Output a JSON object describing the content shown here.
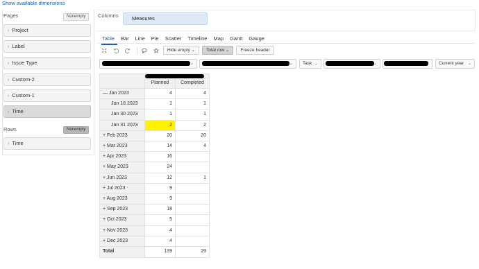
{
  "top_link": "Show available dimensions",
  "pages": {
    "heading": "Pages",
    "nonempty": "Nonempty",
    "items": [
      {
        "label": "Project"
      },
      {
        "label": "Label"
      },
      {
        "label": "Issue Type"
      },
      {
        "label": "Custom-2"
      },
      {
        "label": "Custom-1"
      },
      {
        "label": "Time"
      }
    ]
  },
  "rows": {
    "heading": "Rows",
    "nonempty": "Nonempty",
    "items": [
      {
        "label": "Time"
      }
    ]
  },
  "columns": {
    "heading": "Columns",
    "measures": "Measures"
  },
  "tabs": [
    "Table",
    "Bar",
    "Line",
    "Pie",
    "Scatter",
    "Timeline",
    "Map",
    "Gantt",
    "Gauge"
  ],
  "toolbar": {
    "hide_empty": "Hide empty",
    "total_row": "Total row",
    "freeze_header": "Freeze header",
    "icons": [
      "collapse-icon",
      "undo-icon",
      "redo-icon",
      "comment-icon",
      "bookmark-icon"
    ]
  },
  "filters": {
    "task": "Task",
    "current_year": "Current year"
  },
  "table": {
    "col_headers": [
      "Planned",
      "Completed"
    ],
    "rows": [
      {
        "label": "— Jan 2023",
        "planned": "4",
        "completed": "4",
        "indent": false
      },
      {
        "label": "Jan 18 2023",
        "planned": "1",
        "completed": "1",
        "indent": true
      },
      {
        "label": "Jan 30 2023",
        "planned": "1",
        "completed": "1",
        "indent": true
      },
      {
        "label": "Jan 31 2023",
        "planned": "2",
        "completed": "2",
        "indent": true,
        "highlight": true
      },
      {
        "label": "+ Feb 2023",
        "planned": "20",
        "completed": "20",
        "indent": false
      },
      {
        "label": "+ Mar 2023",
        "planned": "14",
        "completed": "4",
        "indent": false
      },
      {
        "label": "+ Apr 2023",
        "planned": "16",
        "completed": "",
        "indent": false
      },
      {
        "label": "+ May 2023",
        "planned": "24",
        "completed": "",
        "indent": false
      },
      {
        "label": "+ Jun 2023",
        "planned": "12",
        "completed": "1",
        "indent": false
      },
      {
        "label": "+ Jul 2023",
        "planned": "9",
        "completed": "",
        "indent": false
      },
      {
        "label": "+ Aug 2023",
        "planned": "9",
        "completed": "",
        "indent": false
      },
      {
        "label": "+ Sep 2023",
        "planned": "18",
        "completed": "",
        "indent": false
      },
      {
        "label": "+ Oct 2023",
        "planned": "5",
        "completed": "",
        "indent": false
      },
      {
        "label": "+ Nov 2023",
        "planned": "4",
        "completed": "",
        "indent": false
      },
      {
        "label": "+ Dec 2023",
        "planned": "4",
        "completed": "",
        "indent": false
      }
    ],
    "total": {
      "label": "Total",
      "planned": "139",
      "completed": "29"
    }
  },
  "colors": {
    "accent": "#1a5fb4",
    "highlight": "#fff200",
    "measures_bg": "#dde9f7"
  }
}
